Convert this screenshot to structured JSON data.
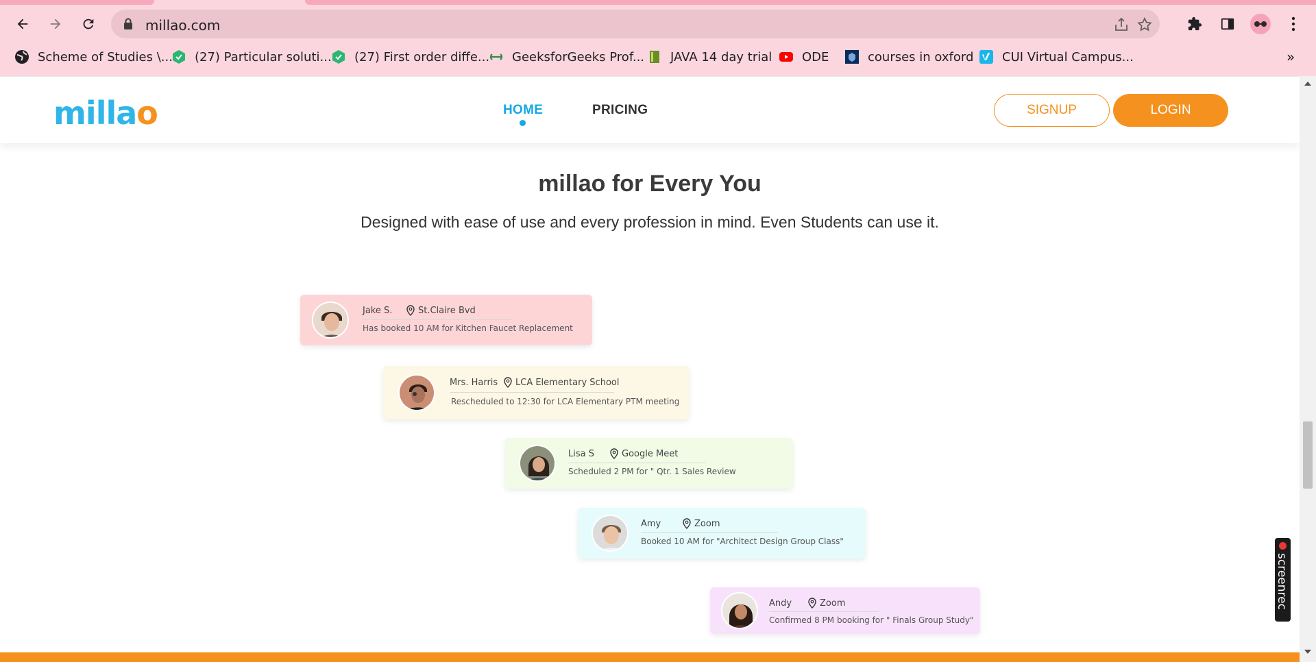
{
  "browser": {
    "url": "millao.com",
    "bookmarks": [
      "Scheme of Studies \\...",
      "(27) Particular soluti...",
      "(27) First order diffe...",
      "GeeksforGeeks Prof...",
      "JAVA 14 day trial",
      "ODE",
      "courses in oxford",
      "CUI Virtual Campus..."
    ],
    "overflow": "»"
  },
  "site": {
    "logo_main": "milla",
    "logo_end": "o",
    "nav": {
      "home": "HOME",
      "pricing": "PRICING"
    },
    "signup": "SIGNUP",
    "login": "LOGIN"
  },
  "section": {
    "title": "millao for Every You",
    "subtitle": "Designed with ease of use and every profession in mind. Even Students can use it."
  },
  "cards": [
    {
      "name": "Jake S.",
      "location": "St.Claire Bvd",
      "message": "Has booked 10 AM for Kitchen Faucet Replacement",
      "bg": "#fdd5d7"
    },
    {
      "name": "Mrs. Harris",
      "location": "LCA Elementary School",
      "message": "Rescheduled to 12:30 for LCA Elementary PTM meeting",
      "bg": "#fdf8e6"
    },
    {
      "name": "Lisa S",
      "location": "Google Meet",
      "message": "Scheduled 2 PM for \" Qtr. 1 Sales Review",
      "bg": "#f1fbe6"
    },
    {
      "name": "Amy",
      "location": "Zoom",
      "message": "Booked 10 AM for \"Architect Design Group Class\"",
      "bg": "#e6fbfc"
    },
    {
      "name": "Andy",
      "location": "Zoom",
      "message": "Confirmed 8 PM booking for \" Finals Group Study\"",
      "bg": "#f8e2fb"
    }
  ],
  "extension": {
    "label": "screenrec"
  },
  "colors": {
    "brand_blue": "#2fb5e8",
    "brand_orange": "#f5911e",
    "chrome_pink": "#fbd6df"
  }
}
